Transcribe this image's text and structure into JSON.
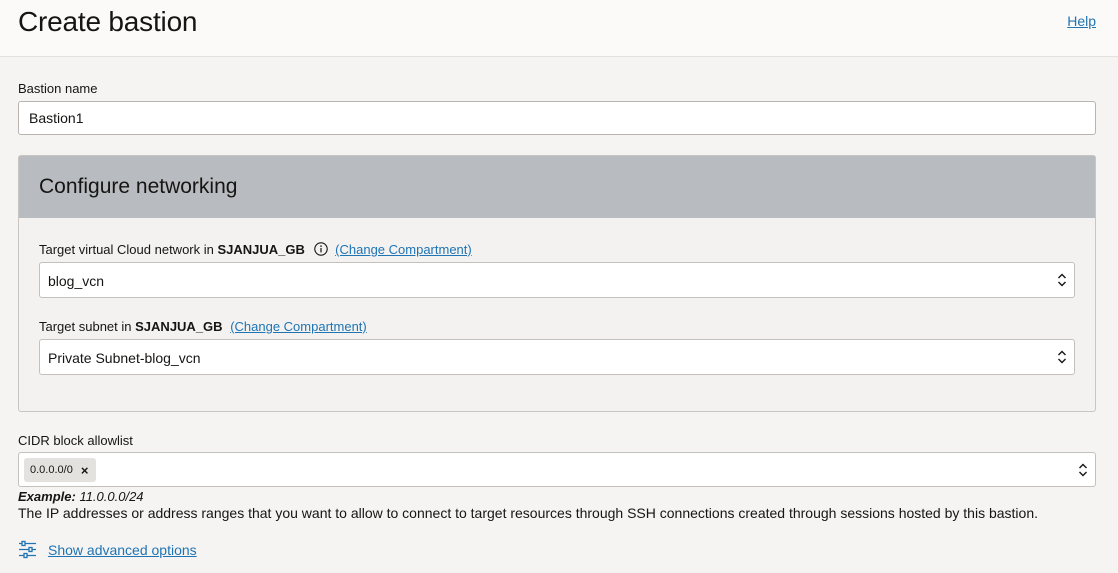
{
  "header": {
    "title": "Create bastion",
    "help_label": "Help"
  },
  "bastion_name": {
    "label": "Bastion name",
    "value": "Bastion1"
  },
  "networking": {
    "title": "Configure networking",
    "vcn": {
      "label_prefix": "Target virtual Cloud network in",
      "compartment": "SJANJUA_GB",
      "change_label": "(Change Compartment)",
      "value": "blog_vcn"
    },
    "subnet": {
      "label_prefix": "Target subnet in",
      "compartment": "SJANJUA_GB",
      "change_label": "(Change Compartment)",
      "value": "Private Subnet-blog_vcn"
    }
  },
  "cidr": {
    "label": "CIDR block allowlist",
    "chips": [
      "0.0.0.0/0"
    ],
    "example_label": "Example:",
    "example_value": "11.0.0.0/24",
    "help": "The IP addresses or address ranges that you want to allow to connect to target resources through SSH connections created through sessions hosted by this bastion."
  },
  "advanced": {
    "label": "Show advanced options",
    "icon": "sliders-icon"
  },
  "colors": {
    "link": "#1f74b4",
    "panel_header": "#b8bbbf",
    "background": "#f5f4f2"
  }
}
